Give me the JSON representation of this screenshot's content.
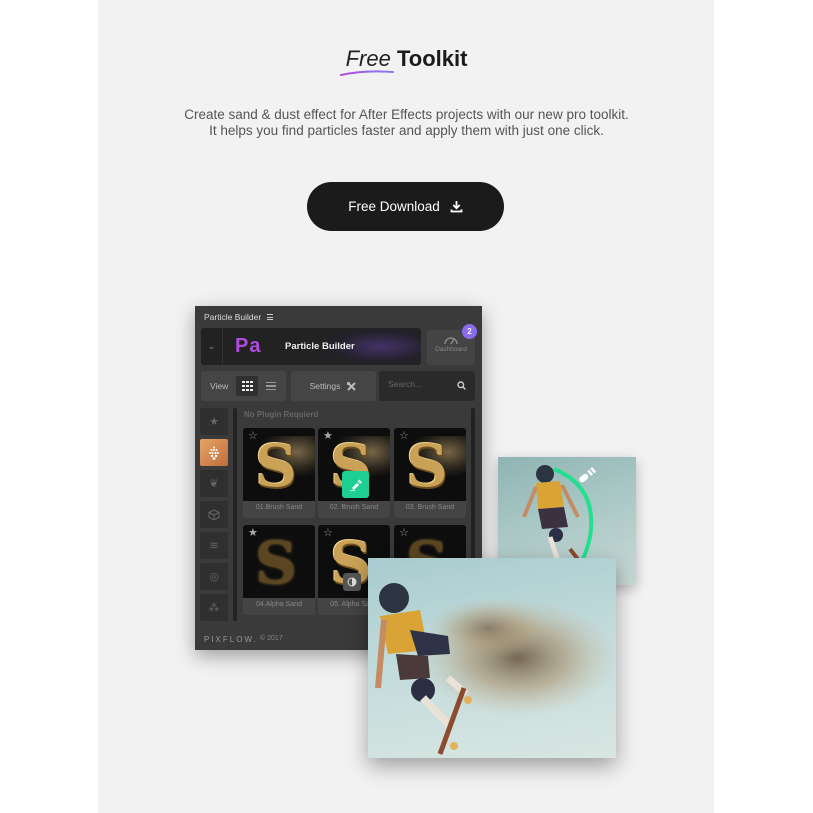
{
  "heading": {
    "free": "Free",
    "toolkit": "Toolkit"
  },
  "subtitle": {
    "line1": "Create sand & dust effect for After Effects projects with our new pro toolkit.",
    "line2": "It helps you find particles faster and apply them with just one click."
  },
  "download_button": {
    "label": "Free Download",
    "icon": "download-icon"
  },
  "colors": {
    "accent_gradient_start": "#b04be0",
    "accent_gradient_end": "#7f7ef0",
    "button_bg": "#1b1b1b",
    "brush_tag": "#1ecf93",
    "badge": "#8c6af0",
    "active_category": "#d98a51"
  },
  "plugin": {
    "window_title": "Particle Builder",
    "menu_icon": "hamburger-icon",
    "brand": {
      "logo_text": "Pa",
      "name": "Particle Builder"
    },
    "dashboard": {
      "label": "Dashboard",
      "badge_count": "2"
    },
    "toolbar": {
      "view_label": "View",
      "settings_label": "Settings",
      "search_placeholder": "Search..."
    },
    "sidebar": [
      {
        "icon": "star-icon",
        "active": false
      },
      {
        "icon": "particles-icon",
        "active": true
      },
      {
        "icon": "laurel-icon",
        "active": false
      },
      {
        "icon": "cube-icon",
        "active": false
      },
      {
        "icon": "wings-icon",
        "active": false
      },
      {
        "icon": "spiral-icon",
        "active": false
      },
      {
        "icon": "magic-wand-icon",
        "active": false
      }
    ],
    "section_label": "No Plugin Requierd",
    "presets": [
      {
        "name": "01.Brush Sand",
        "starred": false,
        "tag": null
      },
      {
        "name": "02. Brush Sand",
        "starred": true,
        "tag": "brush"
      },
      {
        "name": "03. Brush Sand",
        "starred": false,
        "tag": null
      },
      {
        "name": "04.Alpha Sand",
        "starred": true,
        "tag": null
      },
      {
        "name": "05. Alpha Sand",
        "starred": false,
        "tag": "alpha"
      },
      {
        "name": "",
        "starred": false,
        "tag": null
      }
    ],
    "footer": {
      "logo": "PIXFLOW.",
      "copyright": "© 2017"
    }
  }
}
